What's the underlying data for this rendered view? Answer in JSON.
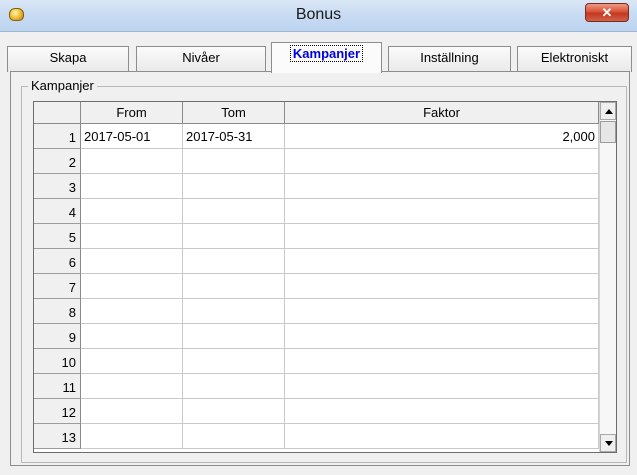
{
  "window": {
    "title": "Bonus",
    "close_glyph": "✕",
    "icon": "coins-icon"
  },
  "tabs": [
    {
      "label": "Skapa"
    },
    {
      "label": "Nivåer"
    },
    {
      "label": "Kampanjer",
      "active": true
    },
    {
      "label": "Inställning"
    },
    {
      "label": "Elektroniskt"
    }
  ],
  "group": {
    "label": "Kampanjer"
  },
  "grid": {
    "columns": [
      "From",
      "Tom",
      "Faktor"
    ],
    "rows": [
      {
        "n": "1",
        "from": "2017-05-01",
        "tom": "2017-05-31",
        "faktor": "2,000"
      },
      {
        "n": "2",
        "from": "",
        "tom": "",
        "faktor": ""
      },
      {
        "n": "3",
        "from": "",
        "tom": "",
        "faktor": ""
      },
      {
        "n": "4",
        "from": "",
        "tom": "",
        "faktor": ""
      },
      {
        "n": "5",
        "from": "",
        "tom": "",
        "faktor": ""
      },
      {
        "n": "6",
        "from": "",
        "tom": "",
        "faktor": ""
      },
      {
        "n": "7",
        "from": "",
        "tom": "",
        "faktor": ""
      },
      {
        "n": "8",
        "from": "",
        "tom": "",
        "faktor": ""
      },
      {
        "n": "9",
        "from": "",
        "tom": "",
        "faktor": ""
      },
      {
        "n": "10",
        "from": "",
        "tom": "",
        "faktor": ""
      },
      {
        "n": "11",
        "from": "",
        "tom": "",
        "faktor": ""
      },
      {
        "n": "12",
        "from": "",
        "tom": "",
        "faktor": ""
      },
      {
        "n": "13",
        "from": "",
        "tom": "",
        "faktor": ""
      }
    ]
  },
  "scrollbar": {
    "up_icon": "arrow-up-icon",
    "down_icon": "arrow-down-icon"
  }
}
